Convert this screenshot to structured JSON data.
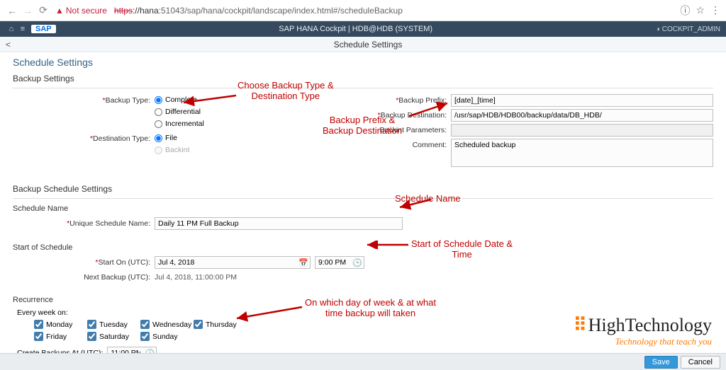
{
  "browser": {
    "not_secure": "Not secure",
    "protocol": "https",
    "host": "://hana",
    "path": ":51043/sap/hana/cockpit/landscape/index.html#/scheduleBackup"
  },
  "header": {
    "title": "SAP HANA Cockpit | HDB@HDB (SYSTEM)",
    "user": "COCKPIT_ADMIN",
    "sap_logo": "SAP"
  },
  "subheader": {
    "title": "Schedule Settings"
  },
  "page_title": "Schedule Settings",
  "sections": {
    "backup": "Backup Settings",
    "schedule": "Backup Schedule Settings",
    "schedule_name": "Schedule Name",
    "start": "Start of Schedule",
    "recurrence": "Recurrence"
  },
  "labels": {
    "backup_type": "Backup Type:",
    "destination_type": "Destination Type:",
    "backup_prefix": "Backup Prefix:",
    "backup_destination": "Backup Destination:",
    "backint_params": "Backint Parameters:",
    "comment": "Comment:",
    "schedule_name": "Unique Schedule Name:",
    "start_on": "Start On (UTC):",
    "next_backup": "Next Backup (UTC):",
    "every_week": "Every week on:",
    "create_backups": "Create Backups At (UTC):"
  },
  "backup_type": {
    "complete": "Complete",
    "differential": "Differential",
    "incremental": "Incremental"
  },
  "destination_type": {
    "file": "File",
    "backint": "Backint"
  },
  "values": {
    "backup_prefix": "[date]_[time]",
    "backup_destination": "/usr/sap/HDB/HDB00/backup/data/DB_HDB/",
    "backint_params": "",
    "comment": "Scheduled backup",
    "schedule_name": "Daily 11 PM Full Backup",
    "start_date": "Jul 4, 2018",
    "start_time": "9:00 PM",
    "next_backup": "Jul 4, 2018, 11:00:00 PM",
    "create_time": "11:00 PM"
  },
  "days": {
    "mon": "Monday",
    "tue": "Tuesday",
    "wed": "Wednesday",
    "thu": "Thursday",
    "fri": "Friday",
    "sat": "Saturday",
    "sun": "Sunday"
  },
  "footer": {
    "save": "Save",
    "cancel": "Cancel"
  },
  "annotations": {
    "a1_l1": "Choose Backup Type &",
    "a1_l2": "Destination Type",
    "a2_l1": "Backup Prefix &",
    "a2_l2": "Backup Destination",
    "a3": "Schedule Name",
    "a4_l1": "Start of Schedule Date &",
    "a4_l2": "Time",
    "a5_l1": "On which day of week & at what",
    "a5_l2": "time backup will taken"
  },
  "watermark": {
    "main": "HighTechnology",
    "sub": "Technology that teach you"
  }
}
